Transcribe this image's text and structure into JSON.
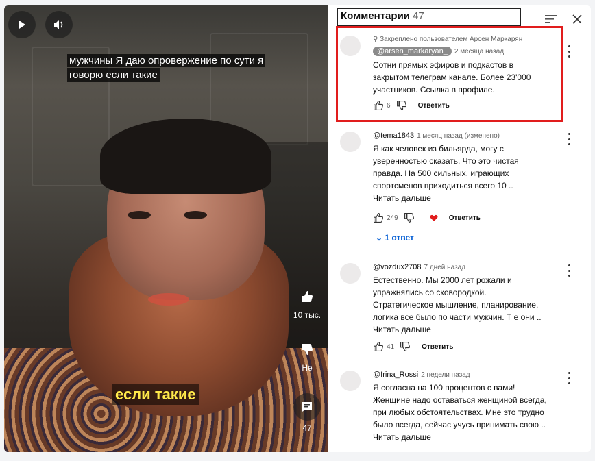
{
  "video": {
    "caption_top": "мужчины Я даю опровержение по сути я говорю если такие",
    "caption_bottom": "если такие",
    "like_count": "10 тыс.",
    "dislike_label": "Не",
    "comments_count": "47",
    "icons": [
      "play-icon",
      "volume-icon",
      "thumb-up-icon",
      "thumb-down-icon",
      "comment-icon"
    ]
  },
  "panel": {
    "title": "Комментарии",
    "count": "47"
  },
  "comments": [
    {
      "pinned": "Закреплено пользователем Арсен Маркарян",
      "author": "@arsen_markaryan_",
      "time": "2 месяца назад",
      "text": "Сотни прямых эфиров и подкастов в закрытом телеграм канале. Более 23'000 участников. Ссылка в профиле.",
      "likes": "6",
      "reply": "Ответить"
    },
    {
      "author": "@tema1843",
      "time": "1 месяц назад (изменено)",
      "text": "Я как человек из бильярда, могу с уверенностью сказать. Что это чистая правда. На 500 сильных, играющих спортсменов приходиться всего 10 ..",
      "more": "Читать дальше",
      "likes": "249",
      "reply": "Ответить",
      "replies": "1 ответ"
    },
    {
      "author": "@vozdux2708",
      "time": "7 дней назад",
      "text": "Естественно. Мы 2000 лет рожали и упражнялись со сковородкой. Стратегическое мышление, планирование, логика все было по части мужчин. Т е они ..",
      "more": "Читать дальше",
      "likes": "41",
      "reply": "Ответить"
    },
    {
      "author": "@Irina_Rossi",
      "time": "2 недели назад",
      "text": "Я согласна на 100 процентов с вами! Женщине надо оставаться женщиной всегда, при любых обстоятельствах. Мне это трудно было всегда, сейчас учусь принимать свою ..",
      "more": "Читать дальше"
    }
  ],
  "colors": {
    "highlight": "#e11d1d",
    "heart": "#e11d1d",
    "link": "#065fd4",
    "caption_yellow": "#ffe94a"
  }
}
